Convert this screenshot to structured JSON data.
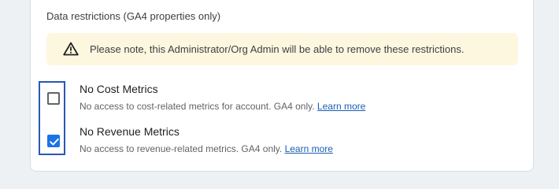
{
  "section": {
    "title": "Data restrictions (GA4 properties only)"
  },
  "notice": {
    "icon": "warning-icon",
    "text": "Please note, this Administrator/Org Admin will be able to remove these restrictions."
  },
  "options": [
    {
      "title": "No Cost Metrics",
      "description": "No access to cost-related metrics for account. GA4 only.",
      "link": "Learn more",
      "checked": false
    },
    {
      "title": "No Revenue Metrics",
      "description": "No access to revenue-related metrics. GA4 only.",
      "link": "Learn more",
      "checked": true
    }
  ],
  "colors": {
    "checkbox_checked": "#1a73e8",
    "notice_bg": "#fef7e0",
    "highlight_border": "#2a57b3",
    "link": "#1a5fb4"
  }
}
